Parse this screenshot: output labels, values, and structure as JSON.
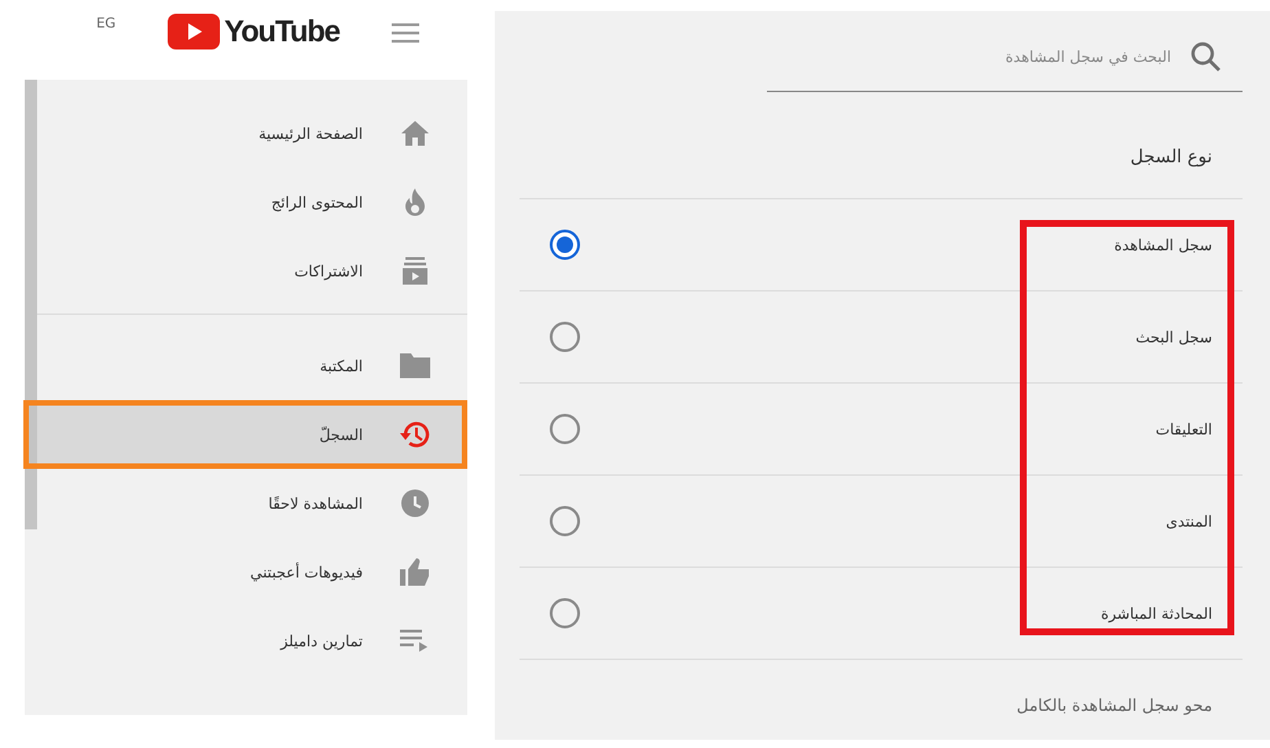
{
  "header": {
    "region": "EG",
    "logo_text": "YouTube"
  },
  "sidebar": {
    "sections": [
      {
        "items": [
          {
            "label": "الصفحة الرئيسية",
            "selected": false,
            "highlighted": false
          },
          {
            "label": "المحتوى الرائج",
            "selected": false,
            "highlighted": false
          },
          {
            "label": "الاشتراكات",
            "selected": false,
            "highlighted": false
          }
        ]
      },
      {
        "items": [
          {
            "label": "المكتبة",
            "selected": false,
            "highlighted": false
          },
          {
            "label": "السجلّ",
            "selected": true,
            "highlighted": true
          },
          {
            "label": "المشاهدة لاحقًا",
            "selected": false,
            "highlighted": false
          },
          {
            "label": "فيديوهات أعجبتني",
            "selected": false,
            "highlighted": false
          },
          {
            "label": "تمارين داميلز",
            "selected": false,
            "highlighted": false
          }
        ]
      }
    ]
  },
  "search": {
    "placeholder": "البحث في سجل المشاهدة"
  },
  "history_type": {
    "title": "نوع السجل",
    "outlined": true,
    "options": [
      {
        "label": "سجل المشاهدة",
        "selected": true
      },
      {
        "label": "سجل البحث",
        "selected": false
      },
      {
        "label": "التعليقات",
        "selected": false
      },
      {
        "label": "المنتدى",
        "selected": false
      },
      {
        "label": "المحادثة المباشرة",
        "selected": false
      }
    ]
  },
  "clear_link": "محو سجل المشاهدة بالكامل"
}
